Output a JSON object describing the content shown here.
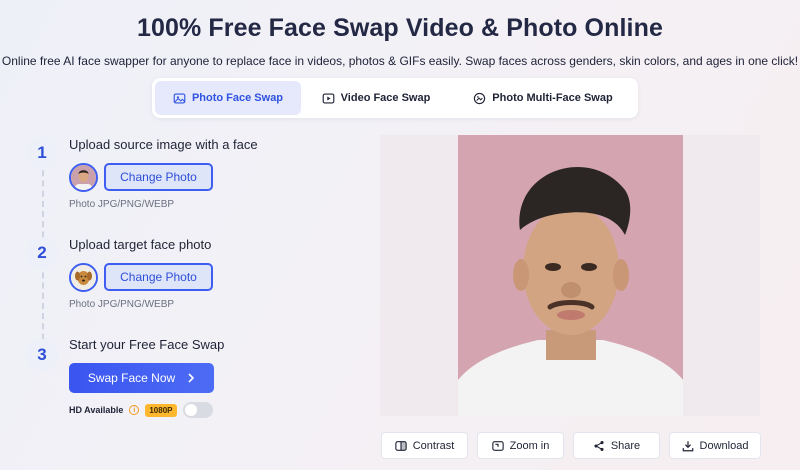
{
  "header": {
    "title": "100% Free Face Swap Video & Photo Online",
    "subtitle": "Online free AI face swapper for anyone to replace face in videos, photos & GIFs easily. Swap faces across genders, skin colors, and ages in one click!"
  },
  "tabs": [
    {
      "label": "Photo Face Swap",
      "icon": "image-icon",
      "active": true
    },
    {
      "label": "Video Face Swap",
      "icon": "video-icon",
      "active": false
    },
    {
      "label": "Photo Multi-Face Swap",
      "icon": "multi-face-icon",
      "active": false
    }
  ],
  "steps": [
    {
      "number": "1",
      "title": "Upload source image with a face",
      "button": "Change Photo",
      "hint": "Photo JPG/PNG/WEBP",
      "thumb": "person-avatar"
    },
    {
      "number": "2",
      "title": "Upload target face photo",
      "button": "Change Photo",
      "hint": "Photo JPG/PNG/WEBP",
      "thumb": "dog-avatar"
    },
    {
      "number": "3",
      "title": "Start your Free Face Swap"
    }
  ],
  "swap_button": {
    "label": "Swap Face Now",
    "icon": "chevron-right-icon"
  },
  "hd": {
    "label": "HD Available",
    "badge": "1080P",
    "enabled": false
  },
  "actions": [
    {
      "label": "Contrast",
      "icon": "contrast-icon"
    },
    {
      "label": "Zoom in",
      "icon": "zoom-icon"
    },
    {
      "label": "Share",
      "icon": "share-icon"
    },
    {
      "label": "Download",
      "icon": "download-icon"
    }
  ],
  "colors": {
    "accent": "#3d5ef0",
    "badge": "#ffb82e",
    "preview_bg": "#d6a7b3"
  }
}
